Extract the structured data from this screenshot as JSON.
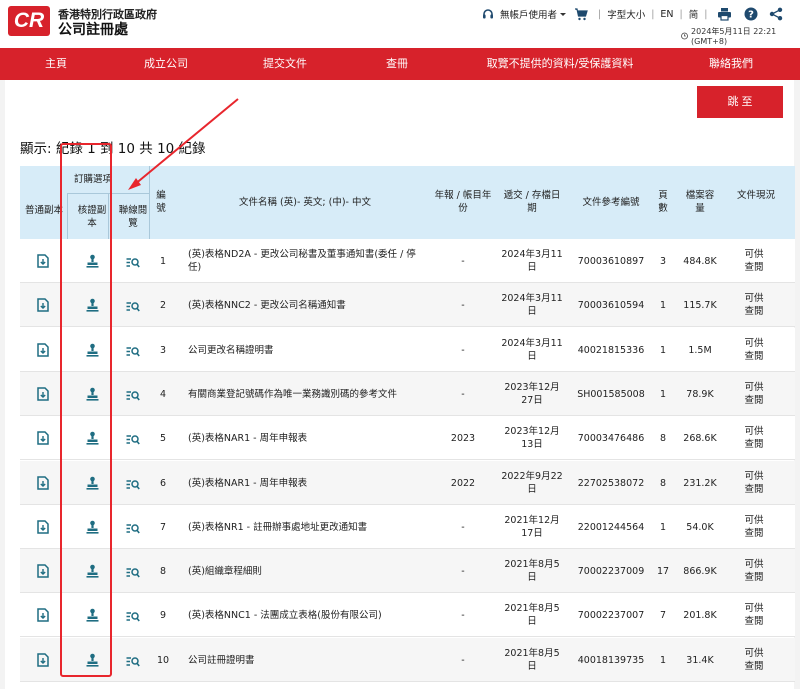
{
  "header": {
    "logo_text": "CR",
    "org_line1": "香港特別行政區政府",
    "org_line2": "公司註冊處",
    "user_label": "無帳戶使用者",
    "font_size_label": "字型大小",
    "lang_en": "EN",
    "lang_sc": "简",
    "datetime": "2024年5月11日 22:21 (GMT+8)"
  },
  "nav": {
    "items": [
      "主頁",
      "成立公司",
      "提交文件",
      "查冊",
      "取覽不提供的資料/受保護資料",
      "聯絡我們"
    ]
  },
  "jump_button": "跳 至",
  "records_text": "顯示: 紀錄 1 到 10 共 10 紀錄",
  "table": {
    "group_header": "訂購選項",
    "headers": {
      "regular_copy": "普通副本",
      "certified_copy": "核證副本",
      "online_view": "聯線閱覽",
      "no": "編號",
      "doc_name": "文件名稱 (英)- 英文; (中)- 中文",
      "year": "年報 / 帳目年份",
      "date": "遞交 / 存檔日期",
      "ref": "文件參考編號",
      "pages": "頁數",
      "size": "檔案容量",
      "status": "文件現況"
    },
    "rows": [
      {
        "no": "1",
        "name": "(英)表格ND2A - 更改公司秘書及董事通知書(委任 / 停任)",
        "year": "-",
        "date": "2024年3月11日",
        "ref": "70003610897",
        "pages": "3",
        "size": "484.8K",
        "status": "可供查閱"
      },
      {
        "no": "2",
        "name": "(英)表格NNC2 - 更改公司名稱通知書",
        "year": "-",
        "date": "2024年3月11日",
        "ref": "70003610594",
        "pages": "1",
        "size": "115.7K",
        "status": "可供查閱"
      },
      {
        "no": "3",
        "name": "公司更改名稱證明書",
        "year": "-",
        "date": "2024年3月11日",
        "ref": "40021815336",
        "pages": "1",
        "size": "1.5M",
        "status": "可供查閱"
      },
      {
        "no": "4",
        "name": "有關商業登記號碼作為唯一業務識別碼的參考文件",
        "year": "-",
        "date": "2023年12月27日",
        "ref": "SH001585008",
        "pages": "1",
        "size": "78.9K",
        "status": "可供查閱"
      },
      {
        "no": "5",
        "name": "(英)表格NAR1 - 周年申報表",
        "year": "2023",
        "date": "2023年12月13日",
        "ref": "70003476486",
        "pages": "8",
        "size": "268.6K",
        "status": "可供查閱"
      },
      {
        "no": "6",
        "name": "(英)表格NAR1 - 周年申報表",
        "year": "2022",
        "date": "2022年9月22日",
        "ref": "22702538072",
        "pages": "8",
        "size": "231.2K",
        "status": "可供查閱"
      },
      {
        "no": "7",
        "name": "(英)表格NR1 - 註冊辦事處地址更改通知書",
        "year": "-",
        "date": "2021年12月17日",
        "ref": "22001244564",
        "pages": "1",
        "size": "54.0K",
        "status": "可供查閱"
      },
      {
        "no": "8",
        "name": "(英)組織章程細則",
        "year": "-",
        "date": "2021年8月5日",
        "ref": "70002237009",
        "pages": "17",
        "size": "866.9K",
        "status": "可供查閱"
      },
      {
        "no": "9",
        "name": "(英)表格NNC1 - 法團成立表格(股份有限公司)",
        "year": "-",
        "date": "2021年8月5日",
        "ref": "70002237007",
        "pages": "7",
        "size": "201.8K",
        "status": "可供查閱"
      },
      {
        "no": "10",
        "name": "公司註冊證明書",
        "year": "-",
        "date": "2021年8月5日",
        "ref": "40018139735",
        "pages": "1",
        "size": "31.4K",
        "status": "可供查閱"
      }
    ]
  },
  "colors": {
    "brand_red": "#d7222b",
    "header_blue": "#d7ecf8",
    "icon_teal": "#1f6d82",
    "annotation_red": "#e8262d"
  },
  "icons": {
    "regular_copy": "document-download-icon",
    "certified_copy": "stamp-icon",
    "online_view": "list-search-icon"
  }
}
